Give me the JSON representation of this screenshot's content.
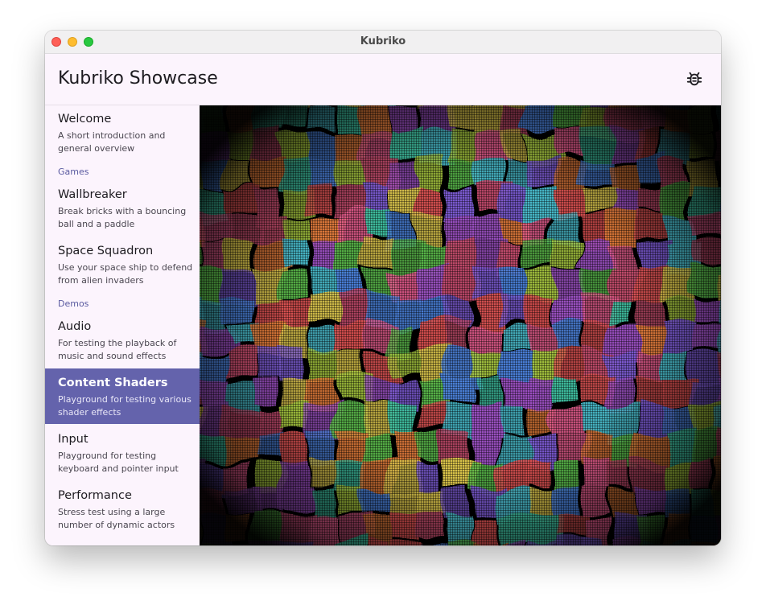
{
  "window": {
    "title": "Kubriko"
  },
  "appbar": {
    "title": "Kubriko Showcase",
    "debug_icon": "bug-icon"
  },
  "sidebar": {
    "items": [
      {
        "label": "Welcome",
        "desc": "A short introduction and general overview"
      },
      {
        "section": "Games"
      },
      {
        "label": "Wallbreaker",
        "desc": "Break bricks with a bouncing ball and a paddle"
      },
      {
        "label": "Space Squadron",
        "desc": "Use your space ship to defend from alien invaders"
      },
      {
        "section": "Demos"
      },
      {
        "label": "Audio",
        "desc": "For testing the playback of music and sound effects"
      },
      {
        "label": "Content Shaders",
        "desc": "Playground for testing various shader effects",
        "selected": true
      },
      {
        "label": "Input",
        "desc": "Playground for testing keyboard and pointer input"
      },
      {
        "label": "Performance",
        "desc": "Stress test using a large number of dynamic actors"
      }
    ]
  },
  "colors": {
    "accent": "#6463ac",
    "surface": "#fcf4fd",
    "palette": [
      "#e05a8a",
      "#3fbfa0",
      "#5ab84a",
      "#9a4fc0",
      "#4a80d8",
      "#d8c24a",
      "#e07a3a",
      "#c04a6a",
      "#48b8c8",
      "#a8c840",
      "#d85050",
      "#7a5ad0"
    ]
  }
}
